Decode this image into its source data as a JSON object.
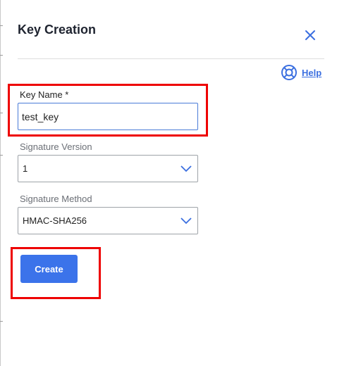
{
  "dialog": {
    "title": "Key Creation",
    "help_label": "Help"
  },
  "form": {
    "key_name": {
      "label": "Key Name *",
      "value": "test_key"
    },
    "signature_version": {
      "label": "Signature Version",
      "selected": "1"
    },
    "signature_method": {
      "label": "Signature Method",
      "selected": "HMAC-SHA256"
    },
    "create_label": "Create"
  },
  "icons": {
    "close": "close-icon",
    "help": "lifebuoy-icon",
    "dropdown": "chevron-down-icon"
  },
  "colors": {
    "accent": "#3b73ea",
    "highlight": "#ee0000",
    "title_text": "#1f2430",
    "label_text": "#6b6f76"
  }
}
